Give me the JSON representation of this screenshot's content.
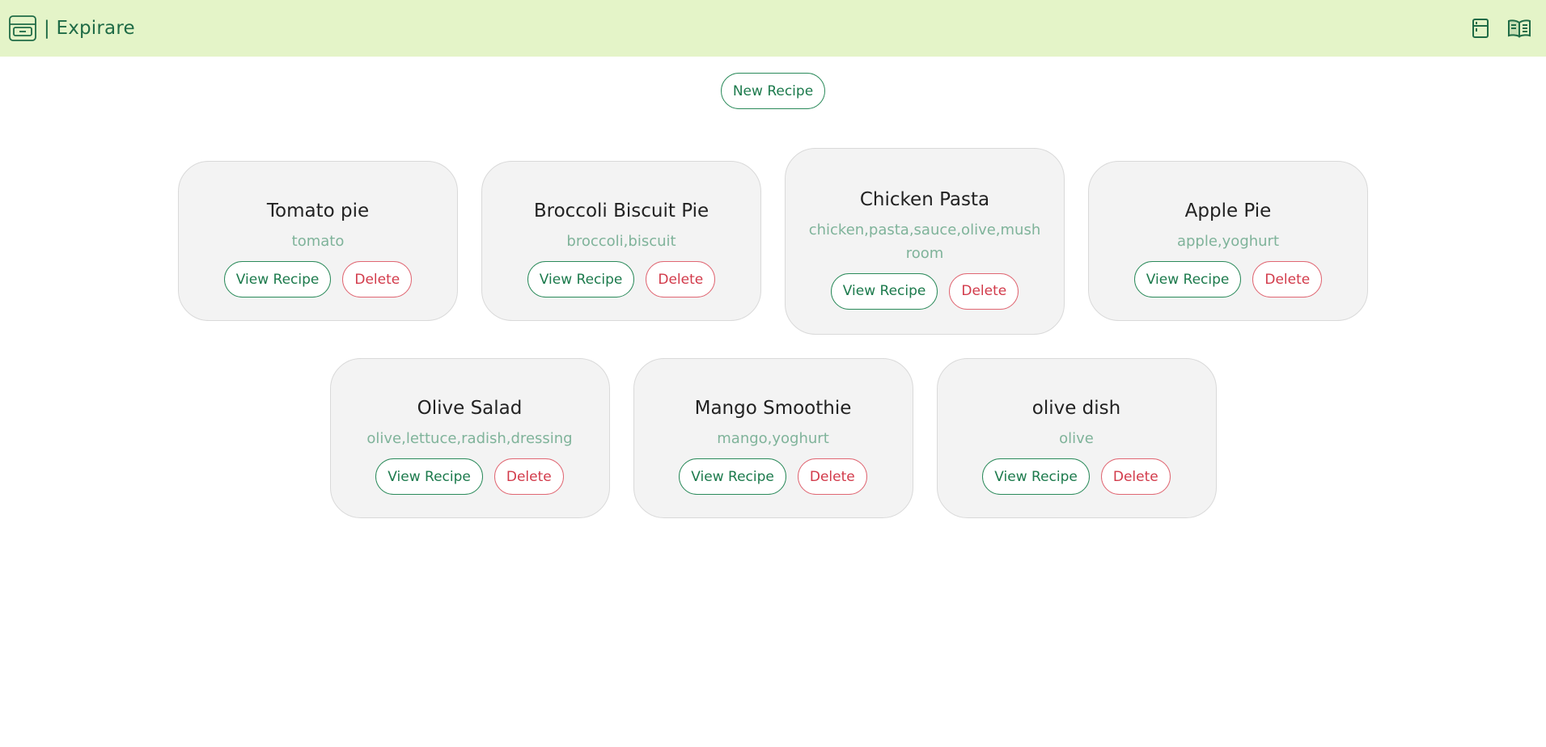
{
  "app": {
    "brand_text": "| Expirare",
    "brand_icon": "fridge-box-icon",
    "nav_icons": [
      "fridge-icon",
      "book-icon"
    ],
    "accent_color": "#1f6b46",
    "navbar_color": "#e4f4c8"
  },
  "actions": {
    "new_recipe_label": "New Recipe"
  },
  "recipes": [
    {
      "title": "Tomato pie",
      "ingredients": "tomato",
      "view_label": "View Recipe",
      "delete_label": "Delete"
    },
    {
      "title": "Broccoli Biscuit Pie",
      "ingredients": "broccoli,biscuit",
      "view_label": "View Recipe",
      "delete_label": "Delete"
    },
    {
      "title": "Chicken Pasta",
      "ingredients": "chicken,pasta,sauce,olive,mushroom",
      "view_label": "View Recipe",
      "delete_label": "Delete"
    },
    {
      "title": "Apple Pie",
      "ingredients": "apple,yoghurt",
      "view_label": "View Recipe",
      "delete_label": "Delete"
    },
    {
      "title": "Olive Salad",
      "ingredients": "olive,lettuce,radish,dressing",
      "view_label": "View Recipe",
      "delete_label": "Delete"
    },
    {
      "title": "Mango Smoothie",
      "ingredients": "mango,yoghurt",
      "view_label": "View Recipe",
      "delete_label": "Delete"
    },
    {
      "title": "olive dish",
      "ingredients": "olive",
      "view_label": "View Recipe",
      "delete_label": "Delete"
    }
  ]
}
